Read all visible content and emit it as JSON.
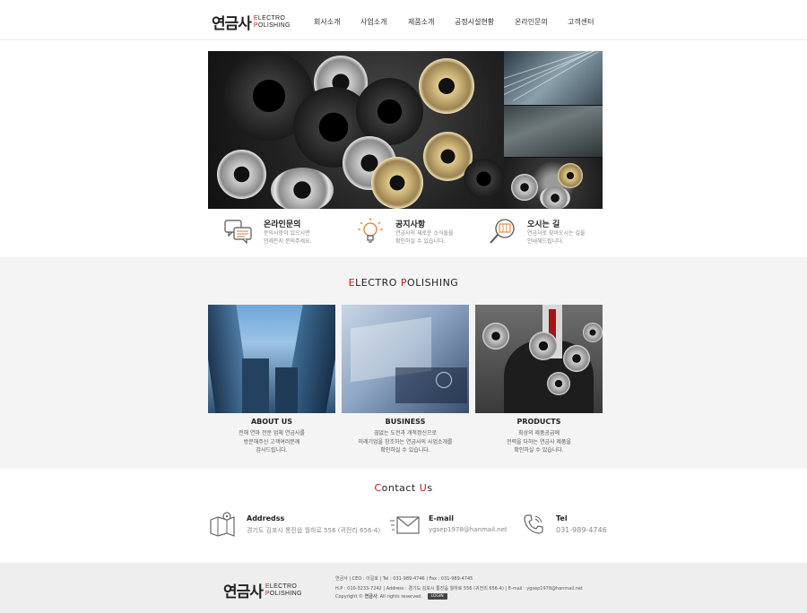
{
  "header": {
    "logo_ko": "연금사",
    "logo_en_line1": {
      "first": "E",
      "rest": "LECTRO"
    },
    "logo_en_line2": {
      "first": "P",
      "rest": "OLISHING"
    },
    "nav": [
      "회사소개",
      "사업소개",
      "제품소개",
      "공정시설현황",
      "온라인문의",
      "고객센터"
    ]
  },
  "info": [
    {
      "title": "온라인문의",
      "desc1": "문의사항이 있으시면",
      "desc2": "언제든지 문의주세요.",
      "icon": "chat-bubbles-icon"
    },
    {
      "title": "공지사항",
      "desc1": "연금사의 새로운 소식들을",
      "desc2": "확인하실 수 있습니다.",
      "icon": "lightbulb-icon"
    },
    {
      "title": "오시는 길",
      "desc1": "연금사로 찾아오시는 길을",
      "desc2": "안내해드립니다.",
      "icon": "magnifier-map-icon"
    }
  ],
  "section": {
    "title_parts": {
      "e": "E",
      "lectro": "LECTRO ",
      "p": "P",
      "olishing": "OLISHING"
    }
  },
  "cards": [
    {
      "title": "ABOUT US",
      "lines": [
        "전해 연마 전문 업체 연금사를",
        "방문해주신 고객여러분께",
        "감사드립니다."
      ]
    },
    {
      "title": "BUSINESS",
      "lines": [
        "끊없는 도전과 개척정신으로",
        "미래기업을 창조하는 연금사의 사업소개를",
        "확인하실 수 있습니다."
      ]
    },
    {
      "title": "PRODUCTS",
      "lines": [
        "최상의 제품공급에",
        "전력을 다하는 연금사 제품을",
        "확인하실 수 있습니다."
      ]
    }
  ],
  "contact": {
    "title_c": "C",
    "title_mid": "ontact ",
    "title_u": "U",
    "title_end": "s",
    "address_label": "Addredss",
    "address_value": "경기도 김포시 통진읍 월하로 556 (귀전리 656-4)",
    "email_label": "E-mail",
    "email_value": "ygsep1978@hanmail.net",
    "tel_label": "Tel",
    "tel_value": "031-989-4746"
  },
  "footer": {
    "line1": "연금사  |  CEO : 이길호  |  Tel : 031-989-4746  |  Fax : 031-989-4745",
    "line2": "H.P : 010-3233-7242  |  Address : 경기도 김포시 통진읍 월하로 556 (귀전리 656-4)  |  E-mail : ygsep1978@hanmail.net",
    "copyright_pre": "Copyright © ",
    "copyright_name": "연금사",
    "copyright_post": ". All rights reserved.",
    "login": "LOGIN"
  },
  "colors": {
    "accent": "#c8161d",
    "footer_bg": "#eeeeee",
    "section_bg": "#f4f4f4"
  }
}
